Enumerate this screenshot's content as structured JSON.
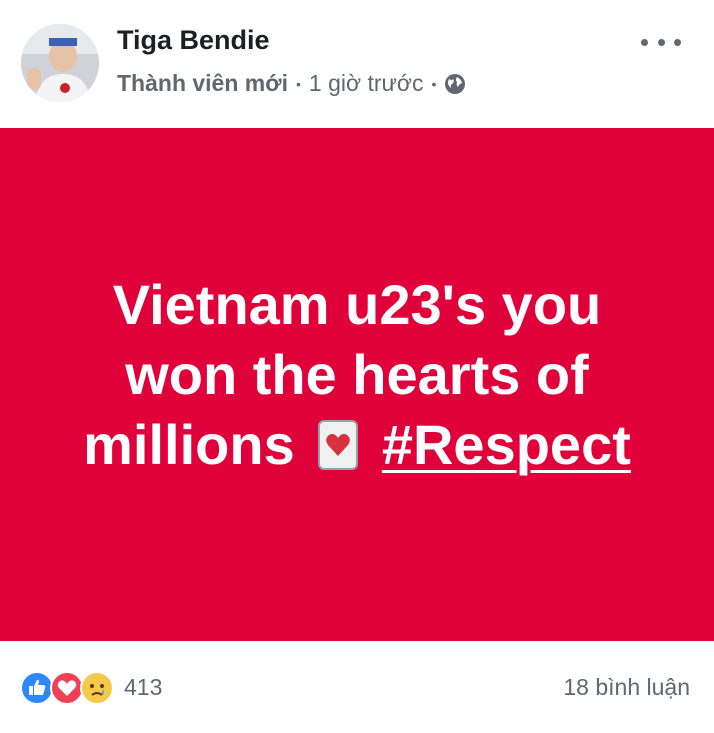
{
  "post": {
    "author": "Tiga Bendie",
    "badge": "Thành viên mới",
    "time": "1 giờ trước",
    "privacy_icon": "globe-icon",
    "text_line1": "Vietnam u23's you",
    "text_line2": "won the hearts of",
    "text_line3_prefix": "millions",
    "hashtag": "#Respect",
    "background_color": "#e0013a"
  },
  "footer": {
    "reaction_icons": [
      "like-icon",
      "love-icon",
      "sad-icon"
    ],
    "reaction_count": "413",
    "comments": "18 bình luận"
  }
}
